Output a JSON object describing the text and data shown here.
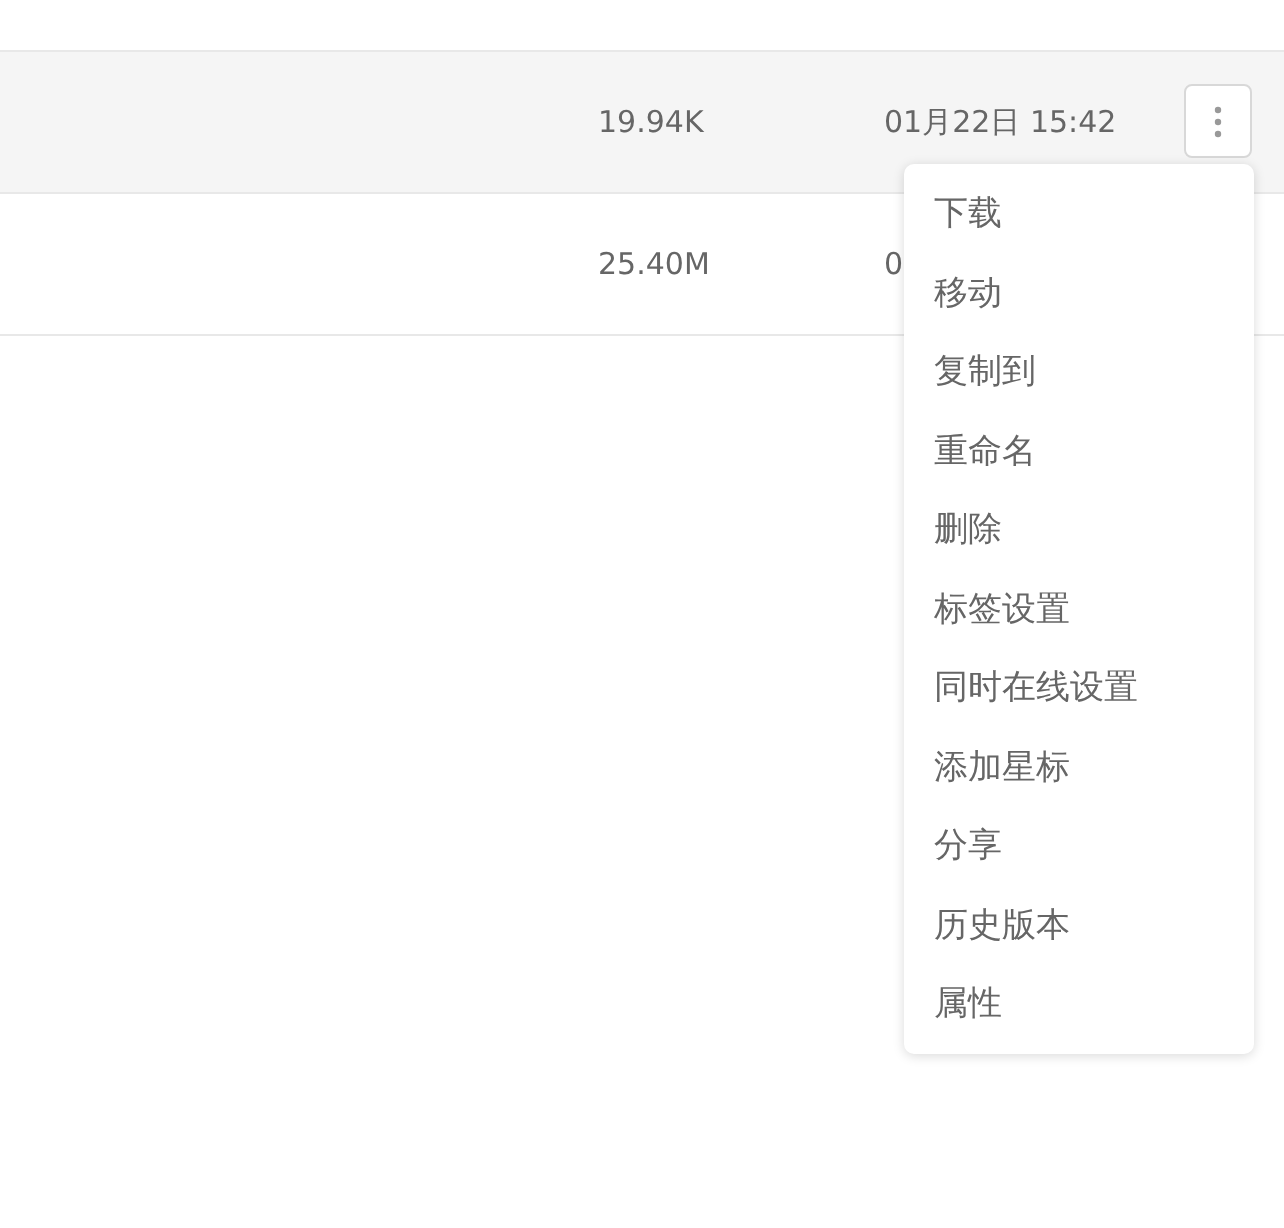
{
  "rows": [
    {
      "size": "19.94K",
      "modified": "01月22日 15:42",
      "selected": true
    },
    {
      "size": "25.40M",
      "modified": "0",
      "selected": false
    }
  ],
  "context_menu": {
    "items": [
      {
        "label": "下载"
      },
      {
        "label": "移动"
      },
      {
        "label": "复制到"
      },
      {
        "label": "重命名"
      },
      {
        "label": "删除"
      },
      {
        "label": "标签设置"
      },
      {
        "label": "同时在线设置"
      },
      {
        "label": "添加星标"
      },
      {
        "label": "分享"
      },
      {
        "label": "历史版本"
      },
      {
        "label": "属性"
      }
    ]
  }
}
